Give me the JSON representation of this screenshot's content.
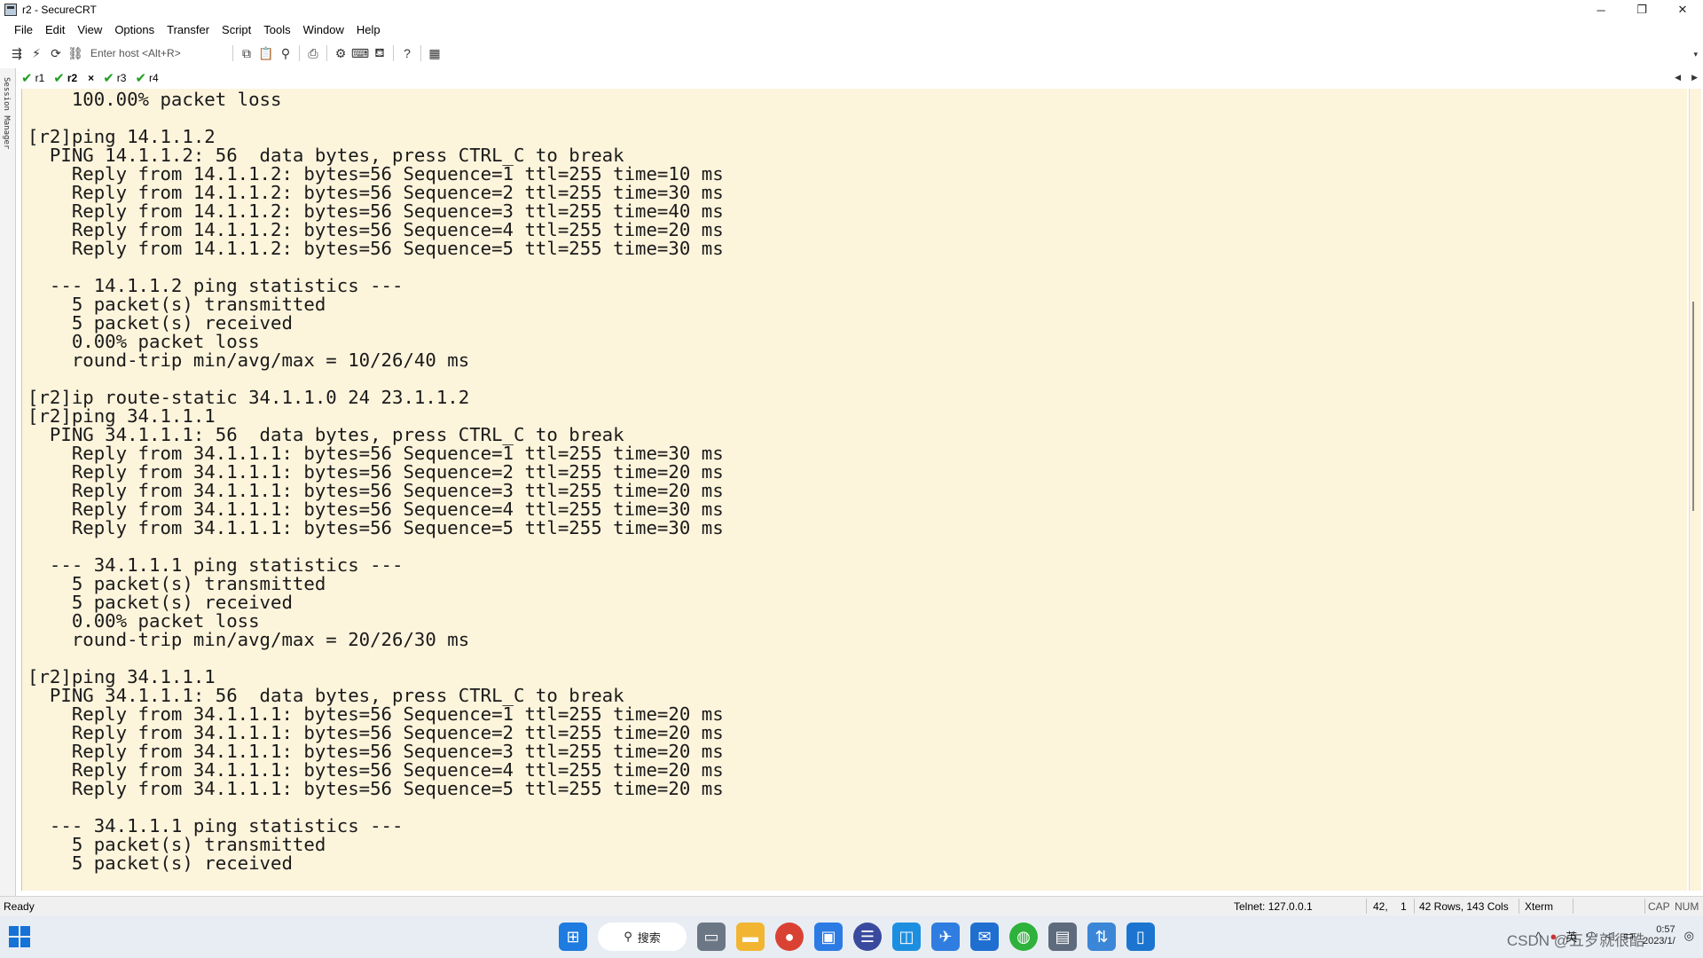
{
  "window": {
    "title": "r2 - SecureCRT",
    "controls": [
      "─",
      "❐",
      "✕"
    ]
  },
  "menu": [
    "File",
    "Edit",
    "View",
    "Options",
    "Transfer",
    "Script",
    "Tools",
    "Window",
    "Help"
  ],
  "toolbar": {
    "host_placeholder": "Enter host <Alt+R>"
  },
  "session_manager": {
    "label": "Session Manager"
  },
  "tabs": [
    {
      "label": "r1",
      "active": false
    },
    {
      "label": "r2",
      "active": true,
      "close": "×"
    },
    {
      "label": "r3",
      "active": false
    },
    {
      "label": "r4",
      "active": false
    }
  ],
  "terminal": {
    "lines": [
      "    100.00% packet loss",
      "",
      "[r2]ping 14.1.1.2",
      "  PING 14.1.1.2: 56  data bytes, press CTRL_C to break",
      "    Reply from 14.1.1.2: bytes=56 Sequence=1 ttl=255 time=10 ms",
      "    Reply from 14.1.1.2: bytes=56 Sequence=2 ttl=255 time=30 ms",
      "    Reply from 14.1.1.2: bytes=56 Sequence=3 ttl=255 time=40 ms",
      "    Reply from 14.1.1.2: bytes=56 Sequence=4 ttl=255 time=20 ms",
      "    Reply from 14.1.1.2: bytes=56 Sequence=5 ttl=255 time=30 ms",
      "",
      "  --- 14.1.1.2 ping statistics ---",
      "    5 packet(s) transmitted",
      "    5 packet(s) received",
      "    0.00% packet loss",
      "    round-trip min/avg/max = 10/26/40 ms",
      "",
      "[r2]ip route-static 34.1.1.0 24 23.1.1.2",
      "[r2]ping 34.1.1.1",
      "  PING 34.1.1.1: 56  data bytes, press CTRL_C to break",
      "    Reply from 34.1.1.1: bytes=56 Sequence=1 ttl=255 time=30 ms",
      "    Reply from 34.1.1.1: bytes=56 Sequence=2 ttl=255 time=20 ms",
      "    Reply from 34.1.1.1: bytes=56 Sequence=3 ttl=255 time=20 ms",
      "    Reply from 34.1.1.1: bytes=56 Sequence=4 ttl=255 time=30 ms",
      "    Reply from 34.1.1.1: bytes=56 Sequence=5 ttl=255 time=30 ms",
      "",
      "  --- 34.1.1.1 ping statistics ---",
      "    5 packet(s) transmitted",
      "    5 packet(s) received",
      "    0.00% packet loss",
      "    round-trip min/avg/max = 20/26/30 ms",
      "",
      "[r2]ping 34.1.1.1",
      "  PING 34.1.1.1: 56  data bytes, press CTRL_C to break",
      "    Reply from 34.1.1.1: bytes=56 Sequence=1 ttl=255 time=20 ms",
      "    Reply from 34.1.1.1: bytes=56 Sequence=2 ttl=255 time=20 ms",
      "    Reply from 34.1.1.1: bytes=56 Sequence=3 ttl=255 time=20 ms",
      "    Reply from 34.1.1.1: bytes=56 Sequence=4 ttl=255 time=20 ms",
      "    Reply from 34.1.1.1: bytes=56 Sequence=5 ttl=255 time=20 ms",
      "",
      "  --- 34.1.1.1 ping statistics ---",
      "    5 packet(s) transmitted",
      "    5 packet(s) received"
    ]
  },
  "status": {
    "ready": "Ready",
    "connection": "Telnet: 127.0.0.1",
    "row": "42,",
    "col": "1",
    "size": "42 Rows, 143 Cols",
    "term": "Xterm",
    "cap": "CAP",
    "num": "NUM"
  },
  "taskbar": {
    "search_label": "搜索",
    "tray_lang": "英",
    "clock_time": "0:57",
    "clock_date": "2023/1/",
    "watermark": "CSDN @五岁就很酷"
  },
  "colors": {
    "terminal_bg": "#fdf4dc",
    "terminal_fg": "#1a1a1a",
    "tab_check": "#1d9e1d",
    "taskbar_bg": "#e8edf3"
  }
}
